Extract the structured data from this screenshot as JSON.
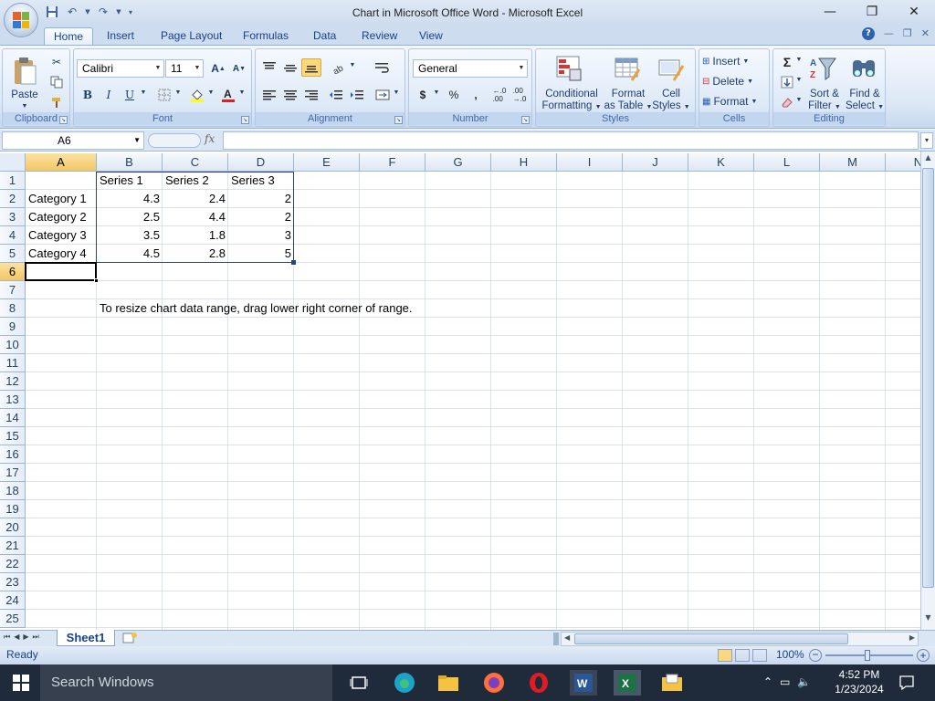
{
  "window": {
    "title": "Chart in Microsoft Office Word - Microsoft Excel",
    "minimize": "—",
    "maximize": "❐",
    "close": "✕"
  },
  "tabs": [
    "Home",
    "Insert",
    "Page Layout",
    "Formulas",
    "Data",
    "Review",
    "View"
  ],
  "ribbon": {
    "clipboard": {
      "label": "Clipboard",
      "paste": "Paste"
    },
    "font": {
      "label": "Font",
      "name": "Calibri",
      "size": "11",
      "bold": "B",
      "italic": "I",
      "underline": "U"
    },
    "alignment": {
      "label": "Alignment"
    },
    "number": {
      "label": "Number",
      "format": "General",
      "currency": "$",
      "percent": "%",
      "comma": ","
    },
    "styles": {
      "label": "Styles",
      "conditional": "Conditional",
      "conditional2": "Formatting",
      "format_table": "Format",
      "format_table2": "as Table",
      "cell_styles": "Cell",
      "cell_styles2": "Styles"
    },
    "cells": {
      "label": "Cells",
      "insert": "Insert",
      "delete": "Delete",
      "format": "Format"
    },
    "editing": {
      "label": "Editing",
      "sort": "Sort &",
      "sort2": "Filter",
      "find": "Find &",
      "find2": "Select"
    }
  },
  "formula_bar": {
    "name_box": "A6",
    "fx": "fx",
    "content": ""
  },
  "columns": [
    "A",
    "B",
    "C",
    "D",
    "E",
    "F",
    "G",
    "H",
    "I",
    "J",
    "K",
    "L",
    "M",
    "N"
  ],
  "rows": [
    "1",
    "2",
    "3",
    "4",
    "5",
    "6",
    "7",
    "8",
    "9",
    "10",
    "11",
    "12",
    "13",
    "14",
    "15",
    "16",
    "17",
    "18",
    "19",
    "20",
    "21",
    "22",
    "23",
    "24",
    "25"
  ],
  "cells": {
    "B1": "Series 1",
    "C1": "Series 2",
    "D1": "Series 3",
    "A2": "Category 1",
    "B2": "4.3",
    "C2": "2.4",
    "D2": "2",
    "A3": "Category 2",
    "B3": "2.5",
    "C3": "4.4",
    "D3": "2",
    "A4": "Category 3",
    "B4": "3.5",
    "C4": "1.8",
    "D4": "3",
    "A5": "Category 4",
    "B5": "4.5",
    "C5": "2.8",
    "D5": "5",
    "B8": "To resize chart data range, drag lower right corner of range."
  },
  "sheet_tab": "Sheet1",
  "status": {
    "ready": "Ready",
    "zoom": "100%"
  },
  "taskbar": {
    "search": "Search Windows",
    "time": "4:52 PM",
    "date": "1/23/2024"
  },
  "colors": {
    "accent": "#15428b",
    "selected_header": "#f3c664",
    "taskbar": "#1f2a3a"
  }
}
